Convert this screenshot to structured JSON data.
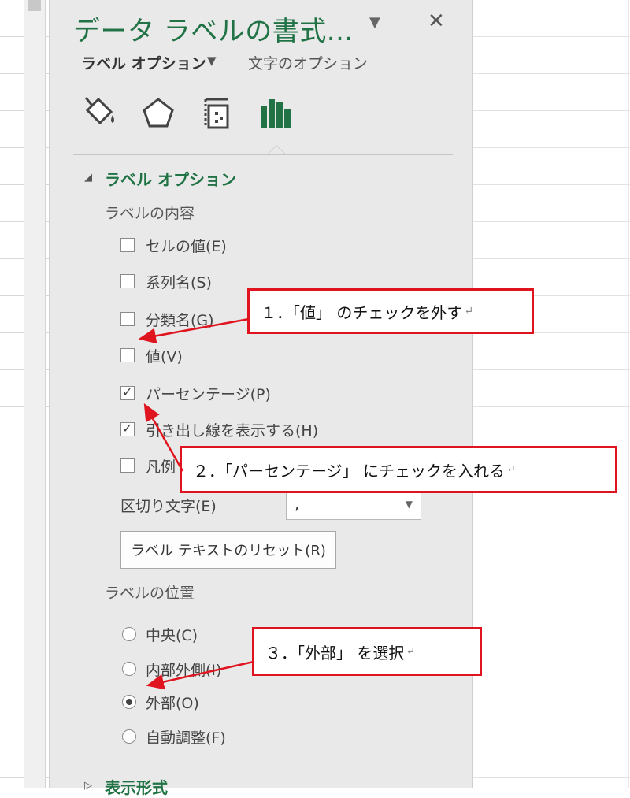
{
  "pane": {
    "title": "データ ラベルの書式...",
    "tabs": {
      "label_options": "ラベル オプション",
      "text_options": "文字のオプション"
    },
    "icons": [
      "fill-line-icon",
      "effects-pentagon-icon",
      "size-properties-icon",
      "label-options-chart-icon"
    ]
  },
  "section": {
    "title": "ラベル オプション",
    "content_heading": "ラベルの内容",
    "checkboxes": [
      {
        "label": "セルの値(E)",
        "checked": false
      },
      {
        "label": "系列名(S)",
        "checked": false
      },
      {
        "label": "分類名(G)",
        "checked": false
      },
      {
        "label": "値(V)",
        "checked": false
      },
      {
        "label": "パーセンテージ(P)",
        "checked": true
      },
      {
        "label": "引き出し線を表示する(H)",
        "checked": true
      },
      {
        "label": "凡例",
        "checked": false
      }
    ],
    "separator_label": "区切り文字(E)",
    "separator_value": ",",
    "reset_button": "ラベル テキストのリセット(R)",
    "position_heading": "ラベルの位置",
    "radios": [
      {
        "label": "中央(C)",
        "checked": false
      },
      {
        "label": "内部外側(I)",
        "checked": false
      },
      {
        "label": "外部(O)",
        "checked": true
      },
      {
        "label": "自動調整(F)",
        "checked": false
      }
    ],
    "next_section": "表示形式"
  },
  "callouts": [
    {
      "text": "１．「値」 のチェックを外す"
    },
    {
      "text": "２．「パーセンテージ」 にチェックを入れる"
    },
    {
      "text": "３．「外部」 を選択"
    }
  ],
  "colors": {
    "accent_green": "#217346",
    "callout_red": "#e0141e",
    "pane_bg": "#e9e9e9"
  }
}
